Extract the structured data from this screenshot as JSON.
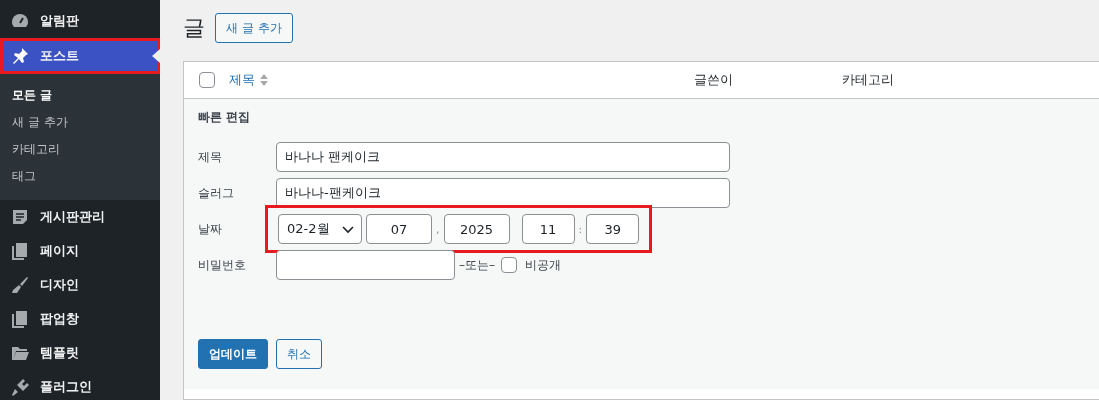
{
  "sidebar": {
    "items": [
      {
        "label": "알림판",
        "kind": "gauge",
        "selected": false,
        "highlighted": false
      },
      {
        "label": "포스트",
        "kind": "pin",
        "selected": true,
        "highlighted": true,
        "children": [
          {
            "label": "모든 글",
            "selected": true
          },
          {
            "label": "새 글 추가",
            "selected": false
          },
          {
            "label": "카테고리",
            "selected": false
          },
          {
            "label": "태그",
            "selected": false
          }
        ]
      },
      {
        "label": "게시판관리",
        "kind": "board",
        "selected": false,
        "highlighted": false
      },
      {
        "label": "페이지",
        "kind": "pages",
        "selected": false,
        "highlighted": false
      },
      {
        "label": "디자인",
        "kind": "brush",
        "selected": false,
        "highlighted": false
      },
      {
        "label": "팝업창",
        "kind": "pages",
        "selected": false,
        "highlighted": false
      },
      {
        "label": "템플릿",
        "kind": "folder",
        "selected": false,
        "highlighted": false
      },
      {
        "label": "플러그인",
        "kind": "plug",
        "selected": false,
        "highlighted": false
      }
    ]
  },
  "page": {
    "title": "글",
    "add_button": "새 글 추가"
  },
  "table": {
    "columns": [
      {
        "label": "제목",
        "sortable": true
      },
      {
        "label": "글쓴이",
        "sortable": false
      },
      {
        "label": "카테고리",
        "sortable": false
      }
    ],
    "select_all_checked": false
  },
  "quick_edit": {
    "heading": "빠른 편집",
    "title": {
      "label": "제목",
      "value": "바나나 팬케이크"
    },
    "slug": {
      "label": "슬러그",
      "value": "바나나-팬케이크"
    },
    "date": {
      "label": "날짜",
      "month": "02-2월",
      "day": "07",
      "sep1": ",",
      "year": "2025",
      "hour": "11",
      "sep2": ":",
      "minute": "39",
      "highlighted": true
    },
    "password": {
      "label": "비밀번호",
      "or": "–또는–",
      "private_label": "비공개",
      "private_checked": false
    },
    "buttons": [
      {
        "label": "업데이트",
        "kind": "primary"
      },
      {
        "label": "취소",
        "kind": "secondary"
      }
    ]
  }
}
